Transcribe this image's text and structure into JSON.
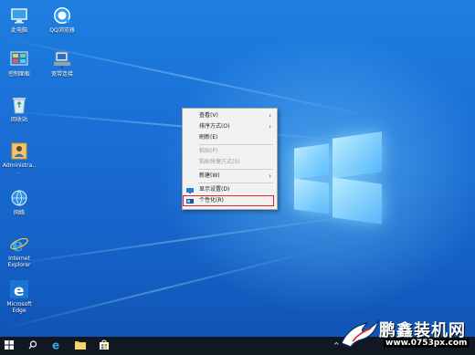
{
  "desktop": {
    "icons_col1": [
      {
        "name": "this-pc-icon",
        "label": "此电脑"
      },
      {
        "name": "control-panel-icon",
        "label": "控制面板"
      },
      {
        "name": "recycle-bin-icon",
        "label": "回收站"
      },
      {
        "name": "admin-user-icon",
        "label": "Administra..."
      },
      {
        "name": "network-icon",
        "label": "网络"
      },
      {
        "name": "ie-icon",
        "label": "Internet Explorer"
      },
      {
        "name": "edge-icon",
        "label": "Microsoft Edge"
      }
    ],
    "icons_col2": [
      {
        "name": "qq-browser-icon",
        "label": "QQ浏览器"
      },
      {
        "name": "broadband-icon",
        "label": "宽带连接"
      }
    ]
  },
  "context_menu": {
    "items": [
      {
        "label": "查看(V)",
        "disabled": false,
        "submenu": true
      },
      {
        "label": "排序方式(O)",
        "disabled": false,
        "submenu": true
      },
      {
        "label": "刷新(E)",
        "disabled": false,
        "submenu": false
      },
      {
        "label": "粘贴(P)",
        "disabled": true,
        "submenu": false
      },
      {
        "label": "粘贴快捷方式(S)",
        "disabled": true,
        "submenu": false
      },
      {
        "label": "新建(W)",
        "disabled": false,
        "submenu": true
      },
      {
        "label": "显示设置(D)",
        "disabled": false,
        "submenu": false,
        "icon": "display-settings-icon"
      },
      {
        "label": "个性化(R)",
        "disabled": false,
        "submenu": false,
        "icon": "personalize-icon",
        "highlighted": true
      }
    ],
    "submenu_arrow": "›"
  },
  "taskbar": {
    "search_glyph": "⌕",
    "chevron": "^"
  },
  "watermark": {
    "title": "鹏鑫装机网",
    "url": "www.0753px.com"
  },
  "colors": {
    "desktop_top": "#1e7fe0",
    "desktop_bottom": "#0f52b2",
    "taskbar": "#111821",
    "highlight_border": "#e0262e"
  }
}
